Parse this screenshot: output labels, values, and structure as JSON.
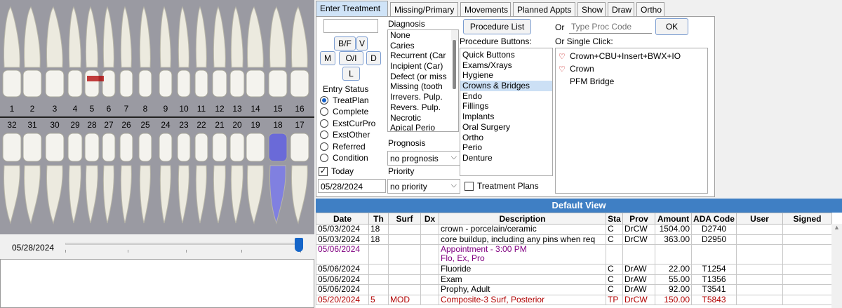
{
  "chart": {
    "upper_numbers": [
      "1",
      "2",
      "3",
      "4",
      "5",
      "6",
      "7",
      "8",
      "9",
      "10",
      "11",
      "12",
      "13",
      "14",
      "15",
      "16"
    ],
    "lower_numbers": [
      "32",
      "31",
      "30",
      "29",
      "28",
      "27",
      "26",
      "25",
      "24",
      "23",
      "22",
      "21",
      "20",
      "19",
      "18",
      "17"
    ],
    "date": "05/28/2024"
  },
  "tabs": [
    "Enter Treatment",
    "Missing/Primary",
    "Movements",
    "Planned Appts",
    "Show",
    "Draw",
    "Ortho"
  ],
  "surface_buttons": {
    "bf": "B/F",
    "v": "V",
    "m": "M",
    "oi": "O/I",
    "d": "D",
    "l": "L"
  },
  "entry_status": {
    "title": "Entry Status",
    "options": [
      "TreatPlan",
      "Complete",
      "ExstCurPro",
      "ExstOther",
      "Referred",
      "Condition"
    ],
    "selected": "TreatPlan"
  },
  "today": {
    "label": "Today",
    "checked": true,
    "date": "05/28/2024"
  },
  "diagnosis": {
    "label": "Diagnosis",
    "items": [
      "None",
      "Caries",
      "Recurrent (Car",
      "Incipient (Car)",
      "Defect (or miss",
      "Missing (tooth",
      "Irrevers. Pulp.",
      "Revers. Pulp.",
      "Necrotic",
      "Apical Perio"
    ]
  },
  "prognosis": {
    "label": "Prognosis",
    "value": "no prognosis"
  },
  "priority": {
    "label": "Priority",
    "value": "no priority"
  },
  "procedure_list_button": "Procedure List",
  "or_label": "Or",
  "proc_code": {
    "placeholder": "Type Proc Code"
  },
  "ok_button": "OK",
  "procedure_buttons": {
    "label": "Procedure Buttons:",
    "items": [
      "Quick Buttons",
      "Exams/Xrays",
      "Hygiene",
      "Crowns & Bridges",
      "Endo",
      "Fillings",
      "Implants",
      "Oral Surgery",
      "Ortho",
      "Perio",
      "Denture"
    ],
    "selected": "Crowns & Bridges"
  },
  "single_click": {
    "label": "Or Single Click:",
    "items": [
      {
        "label": "Crown+CBU+Insert+BWX+IO",
        "icon": "tooth-icon"
      },
      {
        "label": "Crown",
        "icon": "tooth-icon"
      },
      {
        "label": "PFM Bridge",
        "icon": ""
      }
    ]
  },
  "treatment_plans": {
    "label": "Treatment Plans",
    "checked": false
  },
  "grid": {
    "title": "Default View",
    "columns": [
      "Date",
      "Th",
      "Surf",
      "Dx",
      "Description",
      "Sta",
      "Prov",
      "Amount",
      "ADA Code",
      "User",
      "Signed"
    ],
    "rows": [
      {
        "date": "05/03/2024",
        "th": "18",
        "surf": "",
        "dx": "",
        "desc": "crown - porcelain/ceramic",
        "sta": "C",
        "prov": "DrCW",
        "amount": "1504.00",
        "code": "D2740",
        "user": "",
        "signed": "",
        "color": "#000000"
      },
      {
        "date": "05/03/2024",
        "th": "18",
        "surf": "",
        "dx": "",
        "desc": "core buildup, including any pins when req",
        "sta": "C",
        "prov": "DrCW",
        "amount": "363.00",
        "code": "D2950",
        "user": "",
        "signed": "",
        "color": "#000000"
      },
      {
        "date": "05/06/2024",
        "th": "",
        "surf": "",
        "dx": "",
        "desc": "Appointment - 3:00 PM",
        "desc2": "Flo, Ex, Pro",
        "sta": "",
        "prov": "",
        "amount": "",
        "code": "",
        "user": "",
        "signed": "",
        "color": "#800080"
      },
      {
        "date": "05/06/2024",
        "th": "",
        "surf": "",
        "dx": "",
        "desc": "Fluoride",
        "sta": "C",
        "prov": "DrAW",
        "amount": "22.00",
        "code": "T1254",
        "user": "",
        "signed": "",
        "color": "#000000"
      },
      {
        "date": "05/06/2024",
        "th": "",
        "surf": "",
        "dx": "",
        "desc": "Exam",
        "sta": "C",
        "prov": "DrAW",
        "amount": "55.00",
        "code": "T1356",
        "user": "",
        "signed": "",
        "color": "#000000"
      },
      {
        "date": "05/06/2024",
        "th": "",
        "surf": "",
        "dx": "",
        "desc": "Prophy, Adult",
        "sta": "C",
        "prov": "DrAW",
        "amount": "92.00",
        "code": "T3541",
        "user": "",
        "signed": "",
        "color": "#000000"
      },
      {
        "date": "05/20/2024",
        "th": "5",
        "surf": "MOD",
        "dx": "",
        "desc": "Composite-3 Surf, Posterior",
        "sta": "TP",
        "prov": "DrCW",
        "amount": "150.00",
        "code": "T5843",
        "user": "",
        "signed": "",
        "color": "#b00000"
      }
    ]
  },
  "colors": {
    "accent": "#3f7fc4",
    "chart_bg": "#9a9aa2",
    "tp_red": "#b00000",
    "appt_purple": "#800080",
    "crown_purple": "#6a6ad8"
  }
}
